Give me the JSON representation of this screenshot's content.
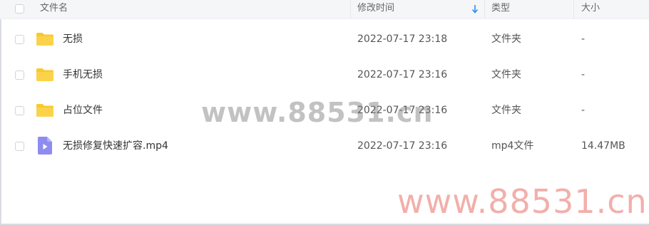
{
  "header": {
    "name_label": "文件名",
    "time_label": "修改时间",
    "type_label": "类型",
    "size_label": "大小"
  },
  "files": [
    {
      "name": "无损",
      "time": "2022-07-17 23:18",
      "type": "文件夹",
      "size": "-",
      "icon": "folder-icon"
    },
    {
      "name": "手机无损",
      "time": "2022-07-17 23:16",
      "type": "文件夹",
      "size": "-",
      "icon": "folder-icon"
    },
    {
      "name": "占位文件",
      "time": "2022-07-17 23:16",
      "type": "文件夹",
      "size": "-",
      "icon": "folder-icon"
    },
    {
      "name": "无损修复快速扩容.mp4",
      "time": "2022-07-17 23:16",
      "type": "mp4文件",
      "size": "14.47MB",
      "icon": "video-file-icon"
    }
  ],
  "watermarks": {
    "center": "www.88531.cn",
    "corner": "www.88531.cn"
  },
  "colors": {
    "folder": "#f9c92b",
    "video": "#8e8cf0",
    "sort_arrow": "#2f8cf5"
  }
}
